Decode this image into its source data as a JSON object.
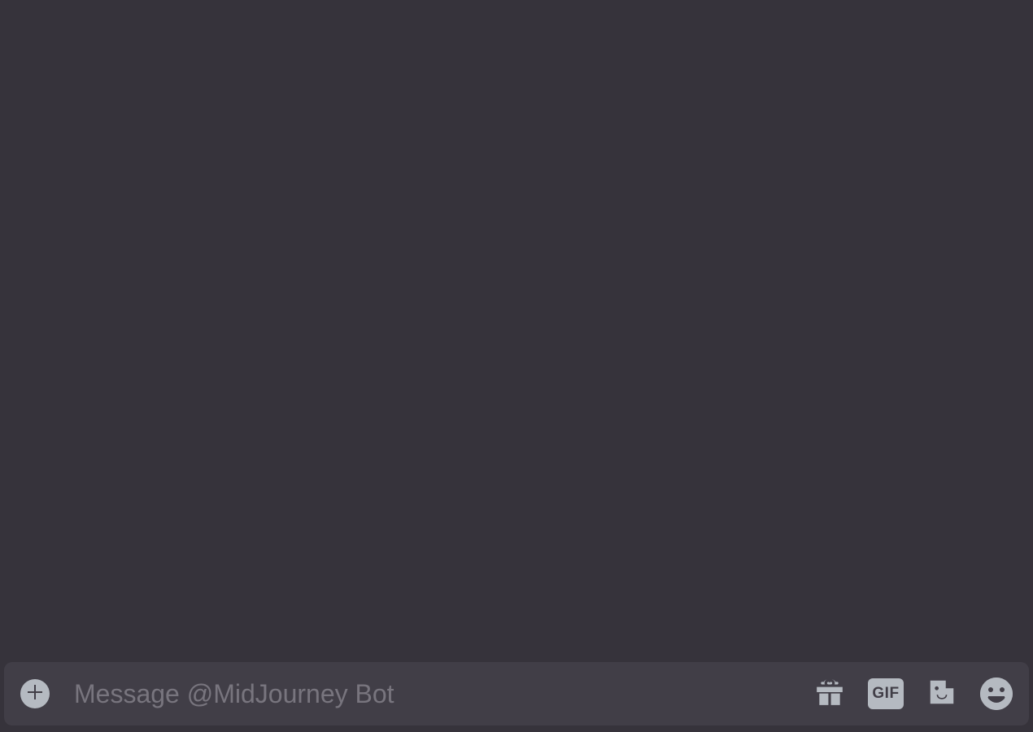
{
  "messageInput": {
    "placeholder": "Message @MidJourney Bot",
    "value": ""
  },
  "gifLabel": "GIF",
  "icons": {
    "add": "plus-circle-icon",
    "gift": "gift-icon",
    "gif": "gif-icon",
    "sticker": "sticker-icon",
    "emoji": "emoji-icon"
  }
}
